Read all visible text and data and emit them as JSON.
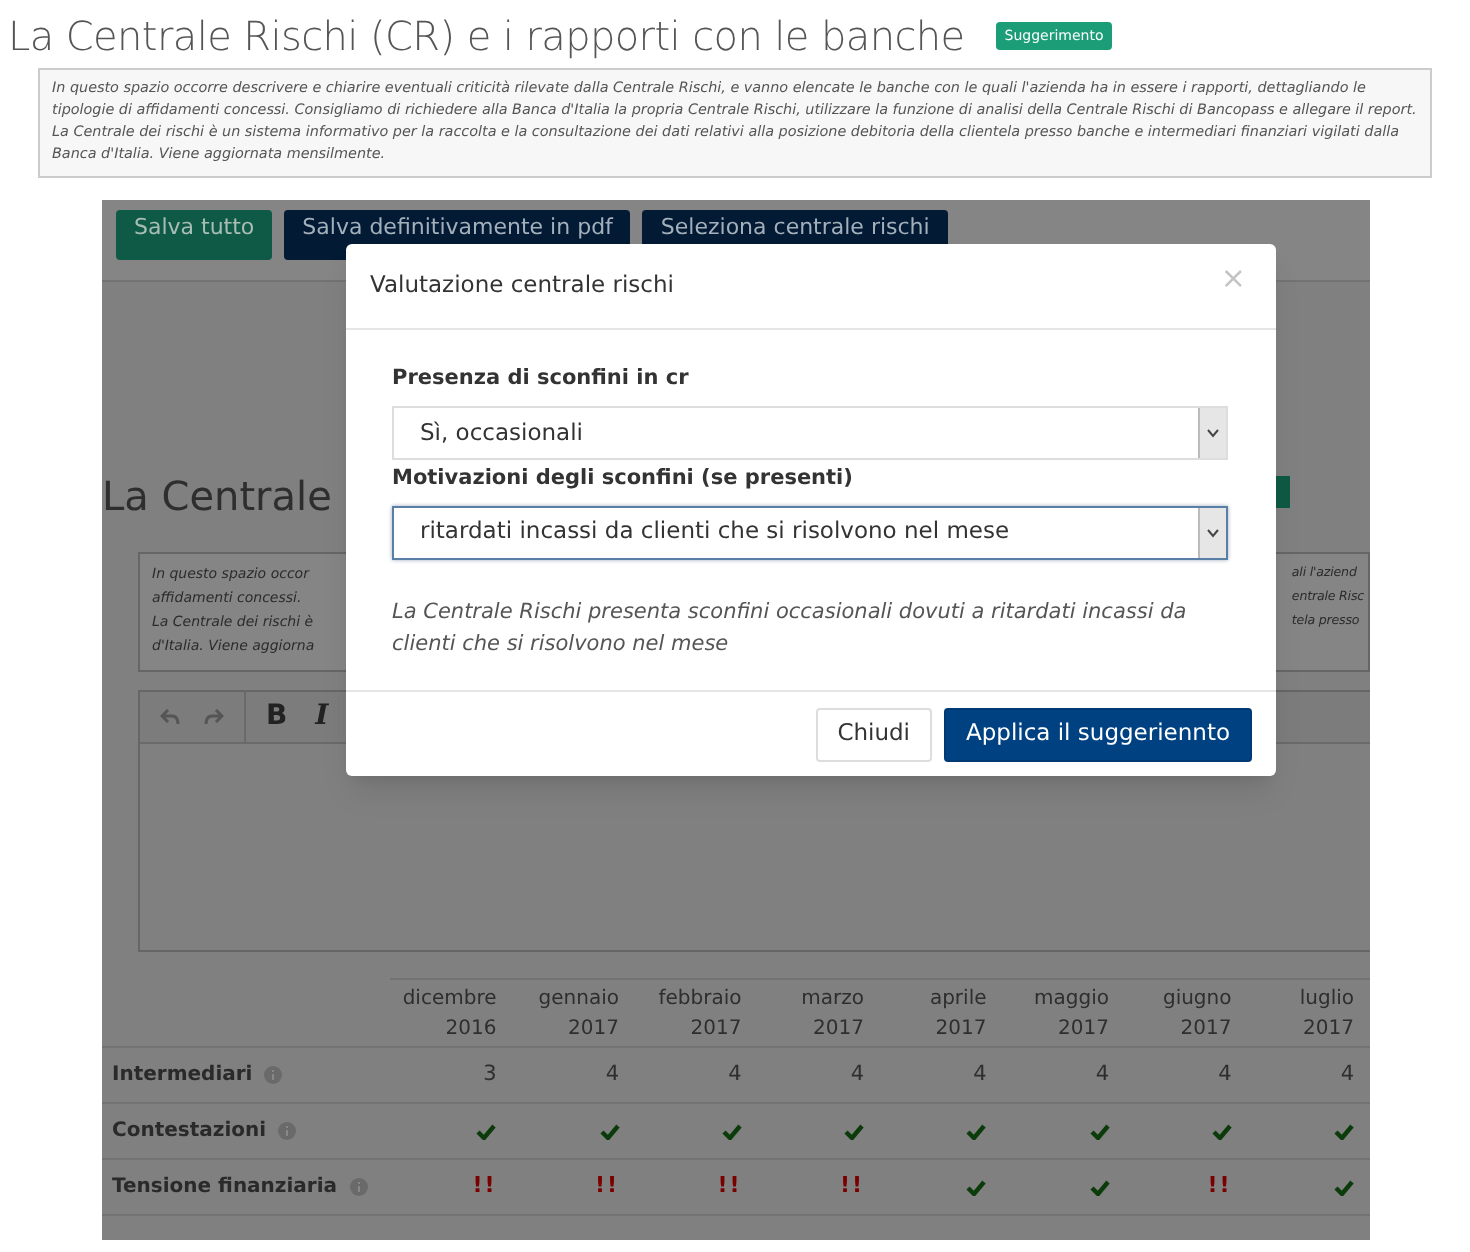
{
  "page": {
    "title": "La Centrale Rischi (CR) e i rapporti con le banche",
    "badge": "Suggerimento",
    "description": [
      "In questo spazio occorre descrivere e chiarire eventuali criticità rilevate dalla Centrale Rischi, e vanno elencate le banche con le quali l'azienda ha in essere i rapporti, dettagliando le tipologie di affidamenti concessi. Consigliamo di richiedere alla Banca d'Italia la propria Centrale Rischi, utilizzare la funzione di analisi della Centrale Rischi di Bancopass e allegare il report.",
      "La Centrale dei rischi è un sistema informativo per la raccolta e la consultazione dei dati relativi alla posizione debitoria della clientela presso banche e intermediari finanziari vigilati dalla Banca d'Italia. Viene aggiornata mensilmente."
    ]
  },
  "background": {
    "buttons": [
      {
        "label": "Salva tutto",
        "kind": "green"
      },
      {
        "label": "Salva definitivamente in pdf",
        "kind": "navy"
      },
      {
        "label": "Seleziona centrale rischi",
        "kind": "navy"
      }
    ],
    "heading": "La Centrale",
    "description_left": [
      "In questo spazio occor",
      "affidamenti concessi. ",
      "La Centrale dei rischi è",
      "d'Italia. Viene aggiorna"
    ],
    "description_right": [
      "ali l'aziend",
      "entrale Risc",
      "tela presso"
    ],
    "toolbar": [
      "B",
      "I"
    ]
  },
  "table": {
    "columns": [
      {
        "month": "dicembre",
        "year": "2016"
      },
      {
        "month": "gennaio",
        "year": "2017"
      },
      {
        "month": "febbraio",
        "year": "2017"
      },
      {
        "month": "marzo",
        "year": "2017"
      },
      {
        "month": "aprile",
        "year": "2017"
      },
      {
        "month": "maggio",
        "year": "2017"
      },
      {
        "month": "giugno",
        "year": "2017"
      },
      {
        "month": "luglio",
        "year": "2017"
      }
    ],
    "rows": [
      {
        "label": "Intermediari",
        "cells": [
          {
            "kind": "text",
            "text": "3"
          },
          {
            "kind": "text",
            "text": "4"
          },
          {
            "kind": "text",
            "text": "4"
          },
          {
            "kind": "text",
            "text": "4"
          },
          {
            "kind": "text",
            "text": "4"
          },
          {
            "kind": "text",
            "text": "4"
          },
          {
            "kind": "text",
            "text": "4"
          },
          {
            "kind": "text",
            "text": "4"
          }
        ]
      },
      {
        "label": "Contestazioni",
        "cells": [
          {
            "kind": "check"
          },
          {
            "kind": "check"
          },
          {
            "kind": "check"
          },
          {
            "kind": "check"
          },
          {
            "kind": "check"
          },
          {
            "kind": "check"
          },
          {
            "kind": "check"
          },
          {
            "kind": "check"
          }
        ]
      },
      {
        "label": "Tensione finanziaria",
        "cells": [
          {
            "kind": "alert",
            "text": "!!"
          },
          {
            "kind": "alert",
            "text": "!!"
          },
          {
            "kind": "alert",
            "text": "!!"
          },
          {
            "kind": "alert",
            "text": "!!"
          },
          {
            "kind": "check"
          },
          {
            "kind": "check"
          },
          {
            "kind": "alert",
            "text": "!!"
          },
          {
            "kind": "check"
          }
        ]
      }
    ]
  },
  "modal": {
    "title": "Valutazione centrale rischi",
    "close": "×",
    "fields": [
      {
        "label": "Presenza di sconfini in cr",
        "value": "Sì, occasionali",
        "focused": false
      },
      {
        "label": "Motivazioni degli sconfini (se presenti)",
        "value": "ritardati incassi da clienti che si risolvono nel mese",
        "focused": true
      }
    ],
    "suggestion": "La Centrale Rischi presenta sconfini occasionali dovuti a ritardati incassi da clienti che si risolvono nel mese",
    "buttons": [
      {
        "label": "Chiudi",
        "kind": "default"
      },
      {
        "label": "Applica il suggeriennto",
        "kind": "primary"
      }
    ]
  }
}
